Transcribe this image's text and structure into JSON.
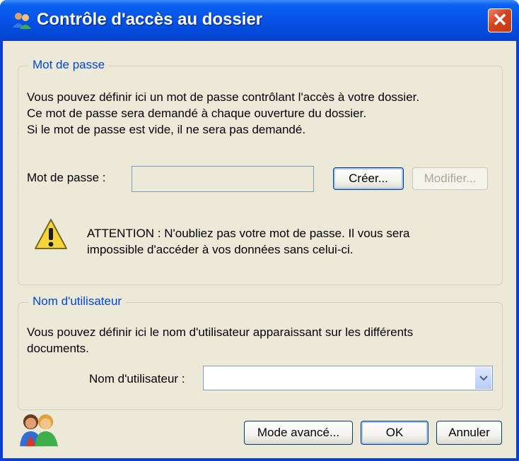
{
  "window": {
    "title": "Contrôle d'accès au dossier",
    "close_glyph": "✕"
  },
  "password_group": {
    "legend": "Mot de passe",
    "description": [
      "Vous pouvez définir ici un mot de passe contrôlant l'accès à votre dossier.",
      "Ce mot de passe sera demandé à chaque ouverture du dossier.",
      "Si le mot de passe est vide, il ne sera pas demandé."
    ],
    "field_label": "Mot de passe :",
    "field_value": "",
    "create_label": "Créer...",
    "modify_label": "Modifier...",
    "warning": [
      "ATTENTION : N'oubliez pas votre mot de passe. Il vous sera",
      "impossible d'accéder à vos données sans celui-ci."
    ]
  },
  "user_group": {
    "legend": "Nom d'utilisateur",
    "description": [
      "Vous pouvez définir ici le nom d'utilisateur apparaissant sur les différents",
      "documents."
    ],
    "field_label": "Nom d'utilisateur :",
    "selected_value": ""
  },
  "footer": {
    "advanced_label": "Mode avancé...",
    "ok_label": "OK",
    "cancel_label": "Annuler"
  },
  "icons": {
    "title": "users-icon",
    "warning": "warning-icon",
    "footer": "users-icon",
    "dropdown": "chevron-down-icon"
  },
  "colors": {
    "titlebar": "#0552e6",
    "client_bg": "#ece9d8",
    "group_legend": "#0046d5",
    "close_button": "#d3431f"
  }
}
